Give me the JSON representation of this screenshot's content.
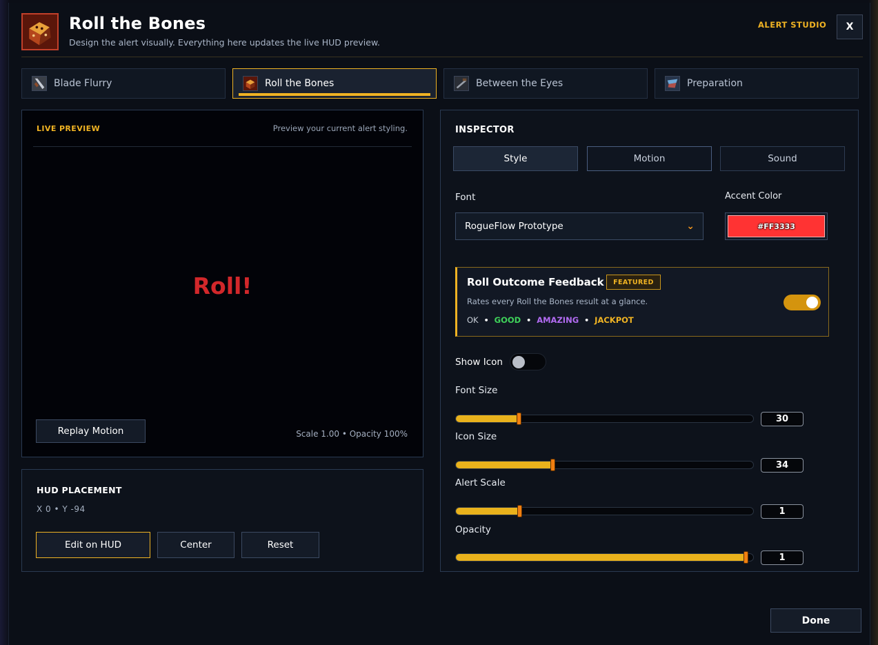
{
  "header": {
    "title": "Roll the Bones",
    "subtitle": "Design the alert visually. Everything here updates the live HUD preview.",
    "studio_label": "ALERT STUDIO",
    "close_label": "X",
    "icon": "dice-icon"
  },
  "tabs": [
    {
      "label": "Blade Flurry",
      "icon": "blade-flurry-icon",
      "active": false
    },
    {
      "label": "Roll the Bones",
      "icon": "roll-the-bones-icon",
      "active": true
    },
    {
      "label": "Between the Eyes",
      "icon": "between-the-eyes-icon",
      "active": false
    },
    {
      "label": "Preparation",
      "icon": "preparation-icon",
      "active": false
    }
  ],
  "preview": {
    "label": "LIVE PREVIEW",
    "note": "Preview your current alert styling.",
    "alert_text": "Roll!",
    "replay_label": "Replay Motion",
    "scale_info": "Scale 1.00  •  Opacity 100%"
  },
  "hud": {
    "title": "HUD PLACEMENT",
    "coords": "X 0   •   Y -94",
    "edit_label": "Edit on HUD",
    "center_label": "Center",
    "reset_label": "Reset"
  },
  "inspector": {
    "title": "INSPECTOR",
    "tabs": [
      {
        "label": "Style",
        "active": true
      },
      {
        "label": "Motion",
        "active": false
      },
      {
        "label": "Sound",
        "active": false
      }
    ],
    "font_label": "Font",
    "font_value": "RogueFlow Prototype",
    "accent_label": "Accent Color",
    "accent_value": "#FF3333",
    "feature": {
      "title": "Roll Outcome Feedback",
      "badge": "FEATURED",
      "description": "Rates every Roll the Bones result at a glance.",
      "tiers": [
        {
          "label": "OK",
          "color": "#c9cfd8"
        },
        {
          "label": "GOOD",
          "color": "#3fd25a"
        },
        {
          "label": "AMAZING",
          "color": "#b26bf2"
        },
        {
          "label": "JACKPOT",
          "color": "#f0b323"
        }
      ],
      "enabled": true
    },
    "show_icon_label": "Show Icon",
    "show_icon_enabled": false,
    "sliders": [
      {
        "label": "Font Size",
        "value": "30",
        "fill": 0.21
      },
      {
        "label": "Icon Size",
        "value": "34",
        "fill": 0.325
      },
      {
        "label": "Alert Scale",
        "value": "1",
        "fill": 0.213
      },
      {
        "label": "Opacity",
        "value": "1",
        "fill": 0.975
      }
    ]
  },
  "footer": {
    "done_label": "Done"
  },
  "colors": {
    "accent": "#f0b323",
    "preview_text": "#d1272a"
  }
}
